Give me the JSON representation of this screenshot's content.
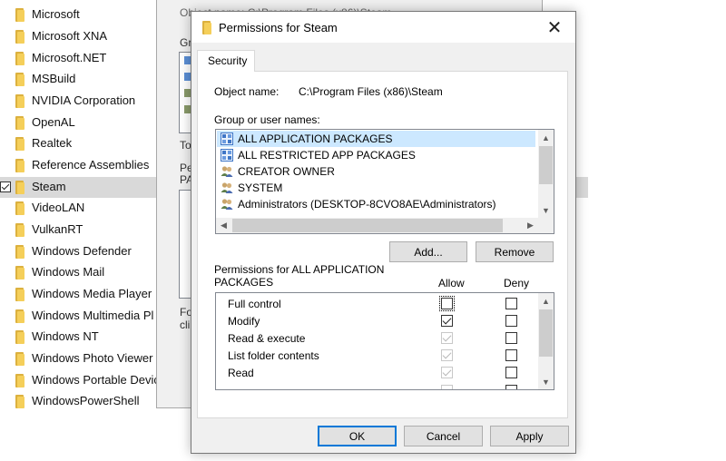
{
  "explorer": {
    "folders": [
      {
        "name": "Microsoft",
        "selected": false
      },
      {
        "name": "Microsoft XNA",
        "selected": false
      },
      {
        "name": "Microsoft.NET",
        "selected": false
      },
      {
        "name": "MSBuild",
        "selected": false
      },
      {
        "name": "NVIDIA Corporation",
        "selected": false
      },
      {
        "name": "OpenAL",
        "selected": false
      },
      {
        "name": "Realtek",
        "selected": false
      },
      {
        "name": "Reference Assemblies",
        "selected": false
      },
      {
        "name": "Steam",
        "selected": true
      },
      {
        "name": "VideoLAN",
        "selected": false
      },
      {
        "name": "VulkanRT",
        "selected": false
      },
      {
        "name": "Windows Defender",
        "selected": false
      },
      {
        "name": "Windows Mail",
        "selected": false
      },
      {
        "name": "Windows Media Player",
        "selected": false
      },
      {
        "name": "Windows Multimedia Pl",
        "selected": false
      },
      {
        "name": "Windows NT",
        "selected": false
      },
      {
        "name": "Windows Photo Viewer",
        "selected": false
      },
      {
        "name": "Windows Portable Devic",
        "selected": false
      },
      {
        "name": "WindowsPowerShell",
        "selected": false
      }
    ]
  },
  "properties_window": {
    "fragments": {
      "object_name": "Object name:    C:\\Program Files (x86)\\Steam",
      "group": "Gr",
      "to": "To",
      "pe": "Pe",
      "pa": "PA",
      "fo": "Fo",
      "cli": "cli"
    }
  },
  "dialog": {
    "title": "Permissions for Steam",
    "close_glyph": "✕",
    "tab_label": "Security",
    "object_name_label": "Object name:",
    "object_name_value": "C:\\Program Files (x86)\\Steam",
    "group_label": "Group or user names:",
    "groups": [
      {
        "name": "ALL APPLICATION PACKAGES",
        "icon": "app-packages-icon",
        "selected": true
      },
      {
        "name": "ALL RESTRICTED APP PACKAGES",
        "icon": "app-packages-icon",
        "selected": false
      },
      {
        "name": "CREATOR OWNER",
        "icon": "users-icon",
        "selected": false
      },
      {
        "name": "SYSTEM",
        "icon": "users-icon",
        "selected": false
      },
      {
        "name": "Administrators (DESKTOP-8CVO8AE\\Administrators)",
        "icon": "users-icon",
        "selected": false
      }
    ],
    "add_label": "Add...",
    "remove_label": "Remove",
    "permissions_label_line1": "Permissions for ALL APPLICATION",
    "permissions_label_line2": "PACKAGES",
    "allow_label": "Allow",
    "deny_label": "Deny",
    "permissions": [
      {
        "name": "Full control",
        "allow": false,
        "allow_disabled": false,
        "deny": false
      },
      {
        "name": "Modify",
        "allow": true,
        "allow_disabled": false,
        "deny": false
      },
      {
        "name": "Read & execute",
        "allow": true,
        "allow_disabled": true,
        "deny": false
      },
      {
        "name": "List folder contents",
        "allow": true,
        "allow_disabled": true,
        "deny": false
      },
      {
        "name": "Read",
        "allow": true,
        "allow_disabled": true,
        "deny": false
      }
    ],
    "ok_label": "OK",
    "cancel_label": "Cancel",
    "apply_label": "Apply"
  },
  "colors": {
    "selection": "#cce8ff",
    "focus_border": "#0078d7",
    "folder_yellow": "#f5cf5a"
  }
}
